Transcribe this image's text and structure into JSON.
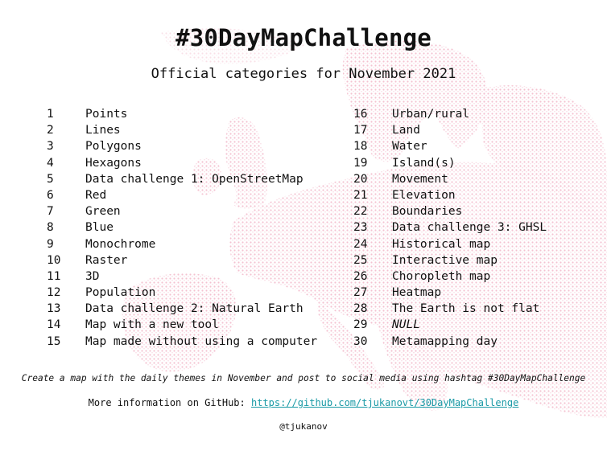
{
  "title": "#30DayMapChallenge",
  "subtitle": "Official categories for November 2021",
  "colors": {
    "map": "#f2b8c9",
    "link": "#1a9aa6",
    "text": "#111111"
  },
  "categories_left": [
    {
      "num": "1",
      "label": "Points"
    },
    {
      "num": "2",
      "label": "Lines"
    },
    {
      "num": "3",
      "label": "Polygons"
    },
    {
      "num": "4",
      "label": "Hexagons"
    },
    {
      "num": "5",
      "label": "Data challenge 1: OpenStreetMap"
    },
    {
      "num": "6",
      "label": "Red"
    },
    {
      "num": "7",
      "label": "Green"
    },
    {
      "num": "8",
      "label": "Blue"
    },
    {
      "num": "9",
      "label": "Monochrome"
    },
    {
      "num": "10",
      "label": "Raster"
    },
    {
      "num": "11",
      "label": "3D"
    },
    {
      "num": "12",
      "label": "Population"
    },
    {
      "num": "13",
      "label": "Data challenge 2: Natural Earth"
    },
    {
      "num": "14",
      "label": "Map with a new tool"
    },
    {
      "num": "15",
      "label": "Map made without using a computer"
    }
  ],
  "categories_right": [
    {
      "num": "16",
      "label": "Urban/rural"
    },
    {
      "num": "17",
      "label": "Land"
    },
    {
      "num": "18",
      "label": "Water"
    },
    {
      "num": "19",
      "label": "Island(s)"
    },
    {
      "num": "20",
      "label": "Movement"
    },
    {
      "num": "21",
      "label": "Elevation"
    },
    {
      "num": "22",
      "label": "Boundaries"
    },
    {
      "num": "23",
      "label": "Data challenge 3: GHSL"
    },
    {
      "num": "24",
      "label": "Historical map"
    },
    {
      "num": "25",
      "label": "Interactive map"
    },
    {
      "num": "26",
      "label": "Choropleth map"
    },
    {
      "num": "27",
      "label": "Heatmap"
    },
    {
      "num": "28",
      "label": "The Earth is not flat"
    },
    {
      "num": "29",
      "label": "NULL"
    },
    {
      "num": "30",
      "label": "Metamapping day"
    }
  ],
  "tagline": "Create a map with the daily themes in November and post to social media using hashtag #30DayMapChallenge",
  "info_prefix": "More information on GitHub: ",
  "info_link": "https://github.com/tjukanovt/30DayMapChallenge",
  "credit": "@tjukanov"
}
